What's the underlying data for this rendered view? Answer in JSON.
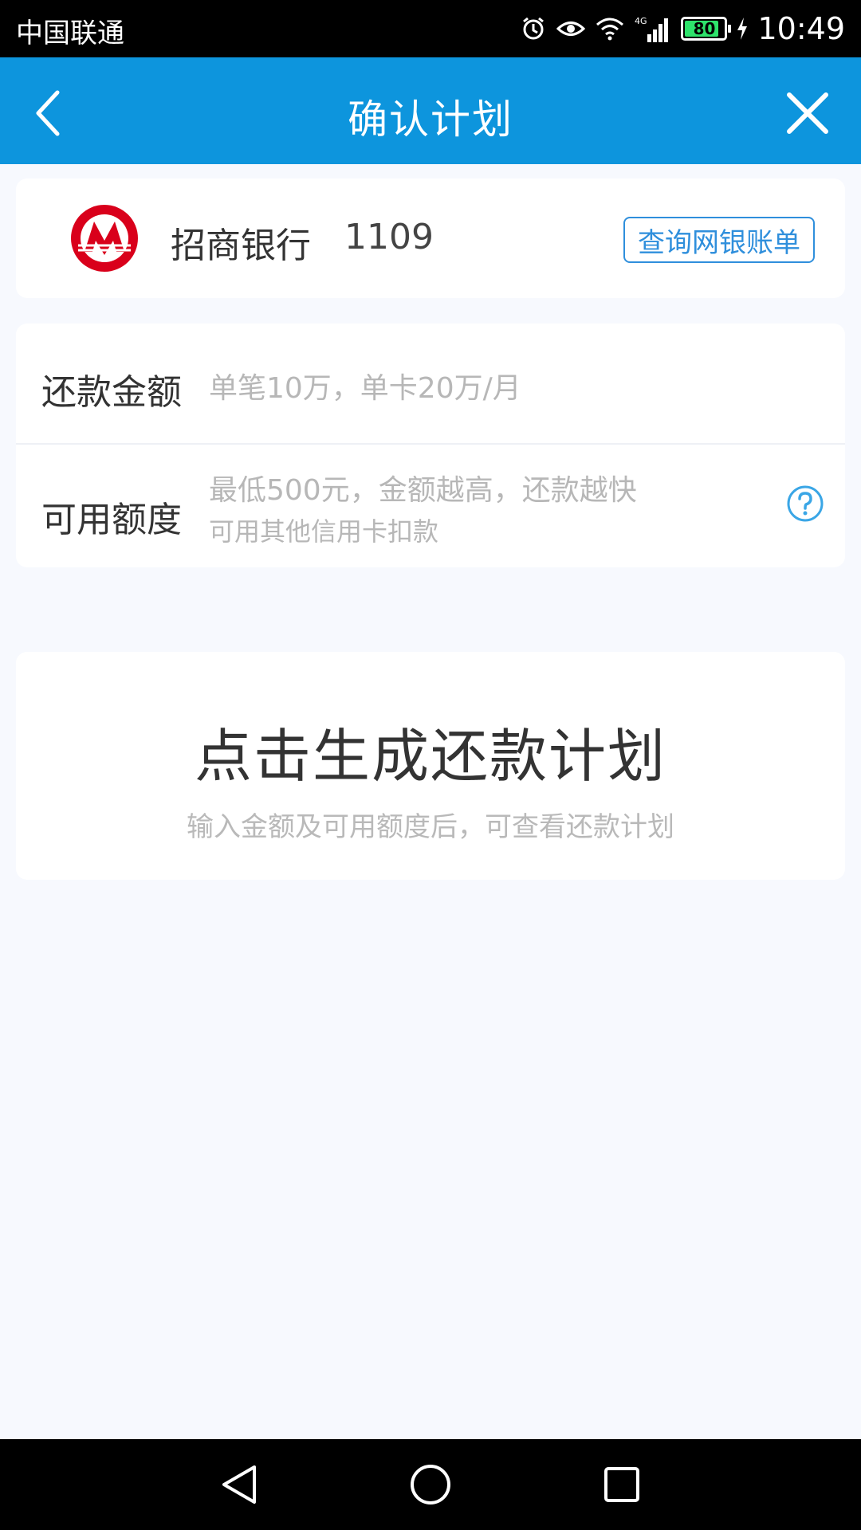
{
  "status_bar": {
    "carrier": "中国联通",
    "network": "4G",
    "battery_level": "80",
    "time": "10:49"
  },
  "app_bar": {
    "title": "确认计划",
    "back_icon": "chevron-left-icon",
    "close_icon": "close-icon"
  },
  "bank_card": {
    "bank_name": "招商银行",
    "card_tail": "1109",
    "logo_icon": "cmb-logo",
    "query_button_label": "查询网银账单"
  },
  "form": {
    "repay_amount": {
      "label": "还款金额",
      "placeholder": "单笔10万，单卡20万/月"
    },
    "available_credit": {
      "label": "可用额度",
      "placeholder": "最低500元，金额越高，还款越快",
      "sub_hint": "可用其他信用卡扣款",
      "help_icon": "question-icon"
    }
  },
  "plan_card": {
    "title": "点击生成还款计划",
    "subtitle": "输入金额及可用额度后，可查看还款计划"
  },
  "colors": {
    "primary": "#0d95dd",
    "accent_border": "#2f8fdc",
    "background": "#f7f9fe",
    "bank_red": "#d9001b",
    "battery_green": "#2ee36b"
  }
}
